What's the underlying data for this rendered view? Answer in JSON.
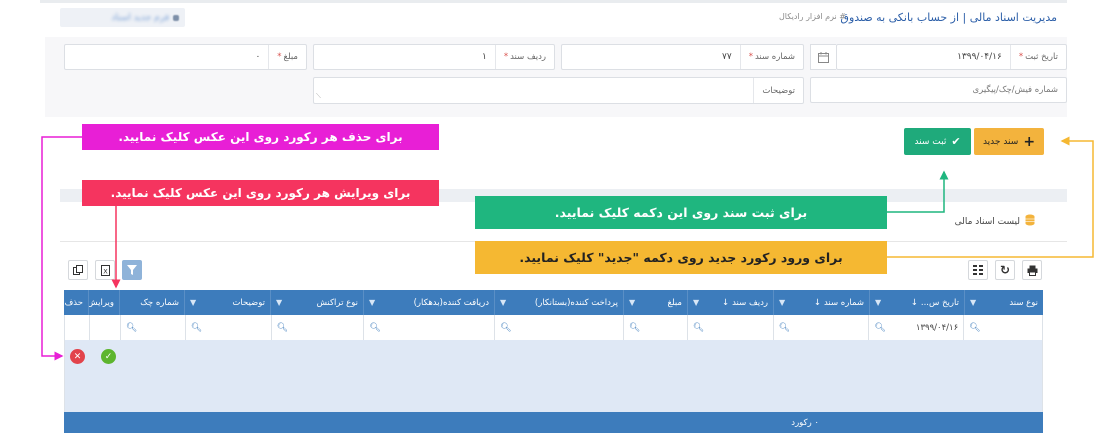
{
  "header": {
    "title": "مدیریت اسناد مالی | از حساب بانکی به صندوق",
    "subtitle": "# نرم افزار رادیکال",
    "blurred_text": "فرم جدید اسناد"
  },
  "form": {
    "date": {
      "label": "تاریخ ثبت",
      "value": "۱۳۹۹/۰۴/۱۶"
    },
    "doc_number": {
      "label": "شماره سند",
      "value": "۷۷"
    },
    "row": {
      "label": "ردیف سند",
      "value": "۱"
    },
    "amount": {
      "label": "مبلغ",
      "value": "۰"
    },
    "receipt": {
      "placeholder": "شماره فیش/چک/پیگیری"
    },
    "description": {
      "placeholder": "توضیحات"
    }
  },
  "buttons": {
    "new_label": "سند جدید",
    "save_label": "ثبت سند"
  },
  "callouts": {
    "delete": "برای حذف هر رکورد روی این عکس کلیک نمایید.",
    "edit": "برای ویرایش هر رکورد روی این عکس کلیک نمایید.",
    "save": "برای ثبت سند روی این دکمه کلیک نمایید.",
    "new": "برای ورود رکورد جدید روی دکمه \"جدید\" کلیک نمایید."
  },
  "section": {
    "title": "لیست اسناد مالی"
  },
  "grid": {
    "columns": [
      "نوع سند",
      "تاریخ س...",
      "شماره سند",
      "ردیف سند",
      "مبلغ",
      "پرداخت کننده(بستانکار)",
      "دریافت کننده(بدهکار)",
      "نوع تراکنش",
      "توضیحات",
      "شماره چک",
      "ویرایش",
      "حذف"
    ],
    "filter_date": "۱۳۹۹/۰۴/۱۶",
    "footer": "۰ رکورد"
  },
  "colors": {
    "accent": "#3d7cbc",
    "new_button": "#f3b33d",
    "save_button": "#1faa7b",
    "callout_delete": "#e81fd6",
    "callout_edit": "#f5345f",
    "callout_save": "#1fb67f",
    "callout_new": "#f5b832"
  }
}
